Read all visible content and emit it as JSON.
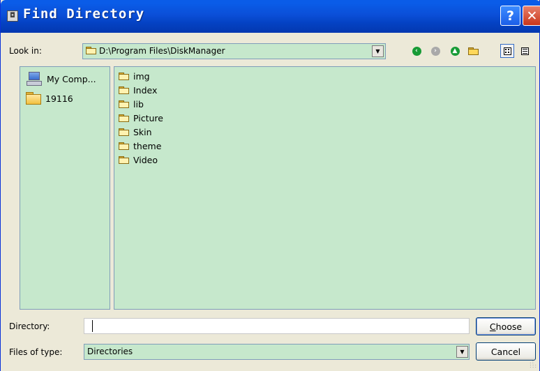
{
  "window": {
    "title": "Find Directory",
    "help_label": "?",
    "close_label": "✕"
  },
  "toolbar": {
    "look_in_label": "Look in:",
    "path": "D:\\Program Files\\DiskManager"
  },
  "sidebar": {
    "items": [
      {
        "label": "My Comp...",
        "icon": "computer-icon"
      },
      {
        "label": "19116",
        "icon": "folder-icon"
      }
    ]
  },
  "files": [
    {
      "name": "img",
      "icon": "folder-icon"
    },
    {
      "name": "Index",
      "icon": "folder-icon"
    },
    {
      "name": "lib",
      "icon": "folder-icon"
    },
    {
      "name": "Picture",
      "icon": "folder-icon"
    },
    {
      "name": "Skin",
      "icon": "folder-icon"
    },
    {
      "name": "theme",
      "icon": "folder-icon"
    },
    {
      "name": "Video",
      "icon": "folder-icon"
    }
  ],
  "directory": {
    "label": "Directory:",
    "value": ""
  },
  "file_type": {
    "label": "Files of type:",
    "selected": "Directories"
  },
  "buttons": {
    "choose_accel": "C",
    "choose_rest": "hoose",
    "cancel": "Cancel"
  },
  "colors": {
    "panel_bg": "#c6e8cc",
    "titlebar": "#0b4fd8",
    "dialog_bg": "#ece9d8"
  }
}
